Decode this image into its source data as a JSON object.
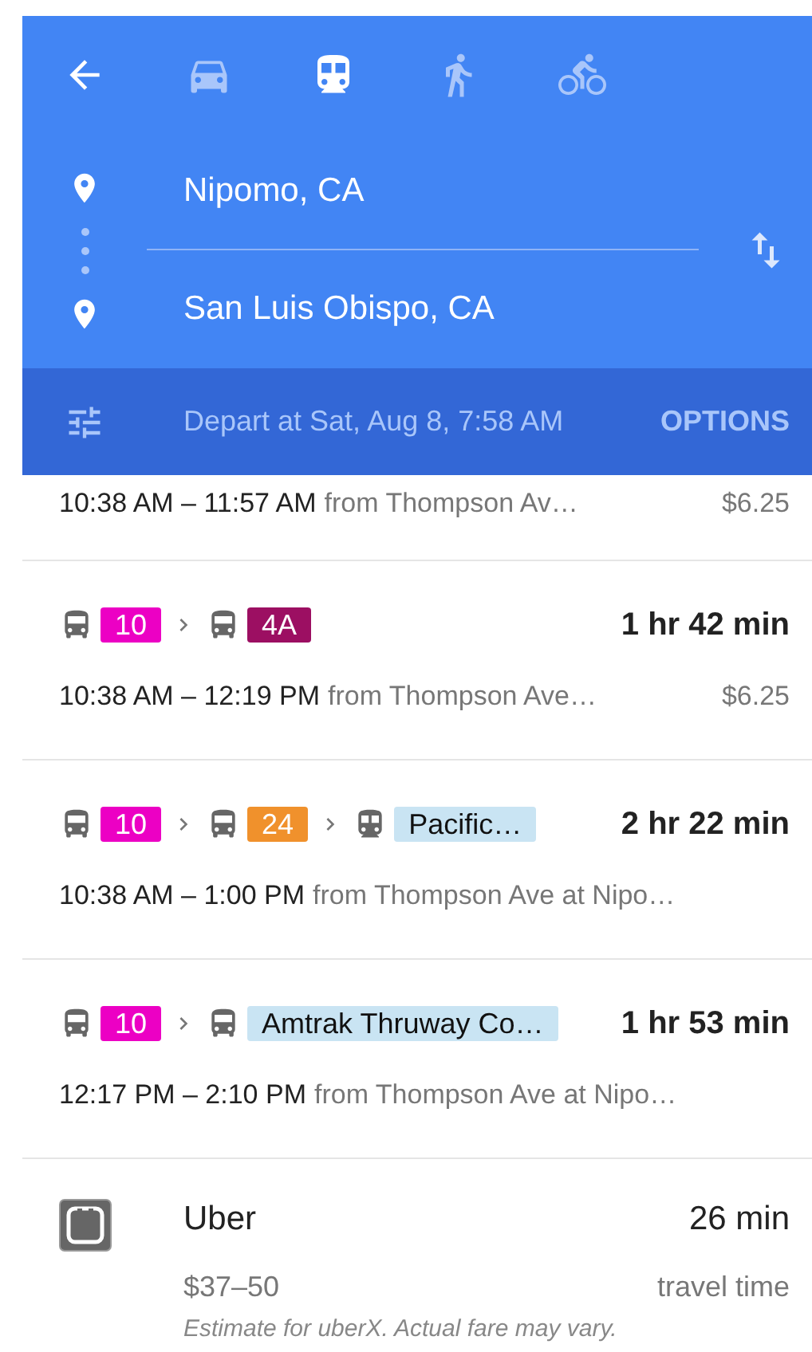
{
  "modes": [
    {
      "kind": "car",
      "selected": false
    },
    {
      "kind": "transit",
      "selected": true
    },
    {
      "kind": "walk",
      "selected": false
    },
    {
      "kind": "bike",
      "selected": false
    }
  ],
  "origin": "Nipomo, CA",
  "destination": "San Luis Obispo, CA",
  "depart": "Depart at Sat, Aug 8, 7:58 AM",
  "options_label": "OPTIONS",
  "routes": [
    {
      "times": "10:38 AM – 11:57 AM",
      "from": "from Thompson Av…",
      "price": "$6.25"
    },
    {
      "segments": [
        {
          "kind": "bus",
          "label": "10",
          "color": "#ec00c4"
        },
        {
          "kind": "bus",
          "label": "4A",
          "color": "#9c0f62"
        }
      ],
      "duration": "1 hr 42 min",
      "times": "10:38 AM – 12:19 PM",
      "from": "from Thompson Ave…",
      "price": "$6.25"
    },
    {
      "segments": [
        {
          "kind": "bus",
          "label": "10",
          "color": "#ec00c4"
        },
        {
          "kind": "bus",
          "label": "24",
          "color": "#f0912c"
        },
        {
          "kind": "train",
          "label": "Pacific…",
          "color": "#c9e4f3"
        }
      ],
      "duration": "2 hr 22 min",
      "times": "10:38 AM – 1:00 PM",
      "from": "from Thompson Ave at Nipo…"
    },
    {
      "segments": [
        {
          "kind": "bus",
          "label": "10",
          "color": "#ec00c4"
        },
        {
          "kind": "bus",
          "label": "Amtrak Thruway Co…",
          "color": "#c9e4f3"
        }
      ],
      "duration": "1 hr 53 min",
      "times": "12:17 PM – 2:10 PM",
      "from": "from Thompson Ave at Nipo…"
    }
  ],
  "ride": {
    "name": "Uber",
    "time": "26 min",
    "price": "$37–50",
    "time_label": "travel time",
    "note": "Estimate for uberX. Actual fare may vary."
  }
}
